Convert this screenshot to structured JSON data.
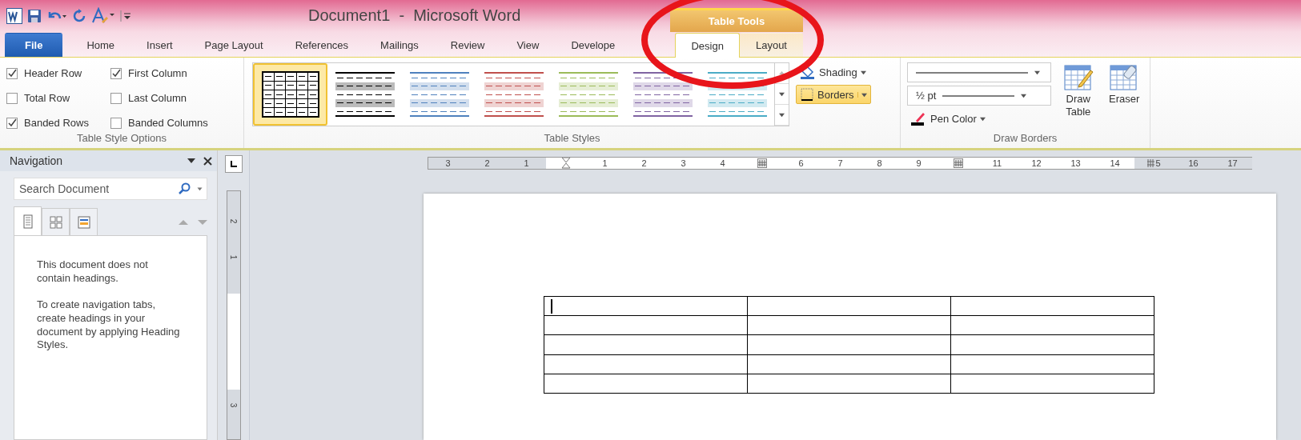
{
  "title_bar": {
    "title": "Document1  -  Microsoft Word",
    "context_group": "Table Tools"
  },
  "tabs": [
    {
      "label": "File",
      "kind": "file",
      "selected": false
    },
    {
      "label": "Home",
      "kind": "normal",
      "selected": false
    },
    {
      "label": "Insert",
      "kind": "normal",
      "selected": false
    },
    {
      "label": "Page Layout",
      "kind": "normal",
      "selected": false
    },
    {
      "label": "References",
      "kind": "normal",
      "selected": false
    },
    {
      "label": "Mailings",
      "kind": "normal",
      "selected": false
    },
    {
      "label": "Review",
      "kind": "normal",
      "selected": false
    },
    {
      "label": "View",
      "kind": "normal",
      "selected": false
    },
    {
      "label": "Develope",
      "kind": "normal",
      "selected": false
    },
    {
      "label": "Design",
      "kind": "context",
      "selected": true
    },
    {
      "label": "Layout",
      "kind": "context",
      "selected": false
    }
  ],
  "style_options": {
    "label": "Table Style Options",
    "options": [
      {
        "label": "Header Row",
        "checked": true
      },
      {
        "label": "First Column",
        "checked": true
      },
      {
        "label": "Total Row",
        "checked": false
      },
      {
        "label": "Last Column",
        "checked": false
      },
      {
        "label": "Banded Rows",
        "checked": true
      },
      {
        "label": "Banded Columns",
        "checked": false
      }
    ]
  },
  "table_styles": {
    "label": "Table Styles",
    "styles": [
      {
        "kind": "grid",
        "color": "#000000",
        "selected": true
      },
      {
        "kind": "banded",
        "color": "#000000",
        "selected": false
      },
      {
        "kind": "banded",
        "color": "#4f81bd",
        "selected": false
      },
      {
        "kind": "banded",
        "color": "#c0504d",
        "selected": false
      },
      {
        "kind": "banded",
        "color": "#9bbb59",
        "selected": false
      },
      {
        "kind": "banded",
        "color": "#8064a2",
        "selected": false
      },
      {
        "kind": "banded",
        "color": "#4bacc6",
        "selected": false
      }
    ],
    "shading": "Shading",
    "borders": "Borders"
  },
  "draw_borders": {
    "label": "Draw Borders",
    "weight": "½ pt",
    "pen_color": "Pen Color",
    "draw_table": "Draw Table",
    "eraser": "Eraser"
  },
  "navigation": {
    "title": "Navigation",
    "search": {
      "placeholder": "Search Document"
    },
    "views": [
      {
        "selected": true
      },
      {
        "selected": false
      },
      {
        "selected": false
      }
    ],
    "messages": [
      "This document does not contain headings.",
      "To create navigation tabs, create headings in your document by applying Heading Styles."
    ]
  },
  "vertical_ruler": [
    "2",
    "1",
    "3"
  ],
  "ruler": [
    {
      "kind": "number",
      "text": "3"
    },
    {
      "kind": "number",
      "text": "2"
    },
    {
      "kind": "number",
      "text": "1"
    },
    {
      "kind": "indent"
    },
    {
      "kind": "number",
      "text": "1"
    },
    {
      "kind": "number",
      "text": "2"
    },
    {
      "kind": "number",
      "text": "3"
    },
    {
      "kind": "number",
      "text": "4"
    },
    {
      "kind": "marker"
    },
    {
      "kind": "number",
      "text": "6"
    },
    {
      "kind": "number",
      "text": "7"
    },
    {
      "kind": "number",
      "text": "8"
    },
    {
      "kind": "number",
      "text": "9"
    },
    {
      "kind": "marker"
    },
    {
      "kind": "number",
      "text": "11"
    },
    {
      "kind": "number",
      "text": "12"
    },
    {
      "kind": "number",
      "text": "13"
    },
    {
      "kind": "number",
      "text": "14"
    },
    {
      "kind": "marker-number",
      "text": "5"
    },
    {
      "kind": "number",
      "text": "16"
    },
    {
      "kind": "number",
      "text": "17"
    }
  ]
}
